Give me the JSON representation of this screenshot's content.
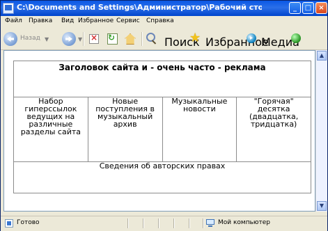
{
  "window": {
    "title": "C:\\Documents and Settings\\Администратор\\Рабочий стол\\Samples\\Macromedi..."
  },
  "menu": {
    "items": [
      "Файл",
      "Правка",
      "Вид",
      "Избранное",
      "Сервис",
      "Справка"
    ]
  },
  "toolbar": {
    "back_label": "Назад",
    "search_label": "Поиск",
    "favorites_label": "Избранное",
    "media_label": "Медиа"
  },
  "page": {
    "header": "Заголовок сайта и - очень часто - реклама",
    "cells": [
      "Набор гиперссылок ведущих на различные разделы сайта",
      "Новые поступления в музыкальный архив",
      "Музыкальные новости",
      "\"Горячая\" десятка (двадцатка, тридцатка)"
    ],
    "footer": "Сведения об авторских правах"
  },
  "status": {
    "ready": "Готово",
    "zone": "Мой компьютер"
  },
  "colors": {
    "title_bar": "#0a58e6",
    "window_bg": "#ece9d8",
    "content_bg": "#ffffff",
    "table_border": "#8c8c8c"
  },
  "icons": {
    "app": "ie-document-icon",
    "back": "back-arrow-icon",
    "forward": "forward-arrow-icon",
    "stop": "stop-icon",
    "refresh": "refresh-icon",
    "home": "home-icon",
    "search": "search-icon",
    "favorites": "favorites-star-icon",
    "media": "media-icon",
    "history": "history-globe-icon",
    "status": "status-page-icon",
    "computer": "my-computer-icon"
  }
}
